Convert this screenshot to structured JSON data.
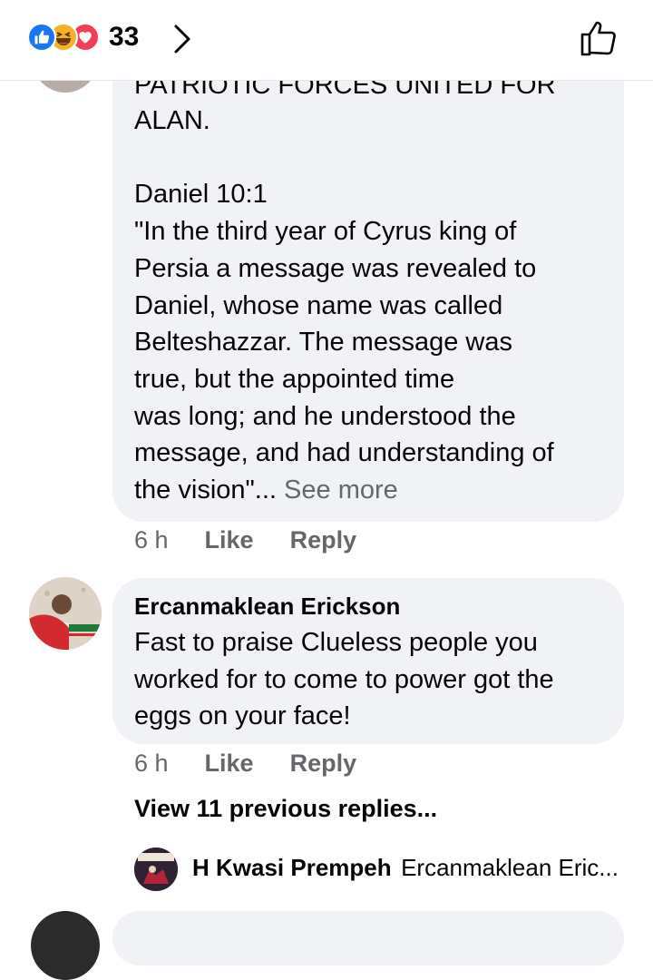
{
  "header": {
    "reaction_count": "33",
    "colors": {
      "like": "#1877f2",
      "haha": "#f7b125",
      "love": "#f33e58"
    }
  },
  "comment1": {
    "text_cut": "PATRIOTIC FORCES UNITED FOR",
    "text": "ALAN.\n\nDaniel 10:1\n\"In the third year of Cyrus king of\nPersia a message was revealed to\nDaniel, whose name was called\nBelteshazzar. The message was\ntrue, but the appointed time\nwas long; and he understood the\nmessage, and had understanding of\nthe vision\"...",
    "see_more": "See more",
    "time": "6 h",
    "like": "Like",
    "reply": "Reply"
  },
  "comment2": {
    "author": "Ercanmaklean Erickson",
    "text": "Fast to praise Clueless people you\nworked for to come to power got the\neggs on your face!",
    "time": "6 h",
    "like": "Like",
    "reply": "Reply"
  },
  "replies": {
    "view_previous": "View 11 previous replies...",
    "latest_author": "H Kwasi Prempeh",
    "latest_preview": "Ercanmaklean Eric..."
  }
}
